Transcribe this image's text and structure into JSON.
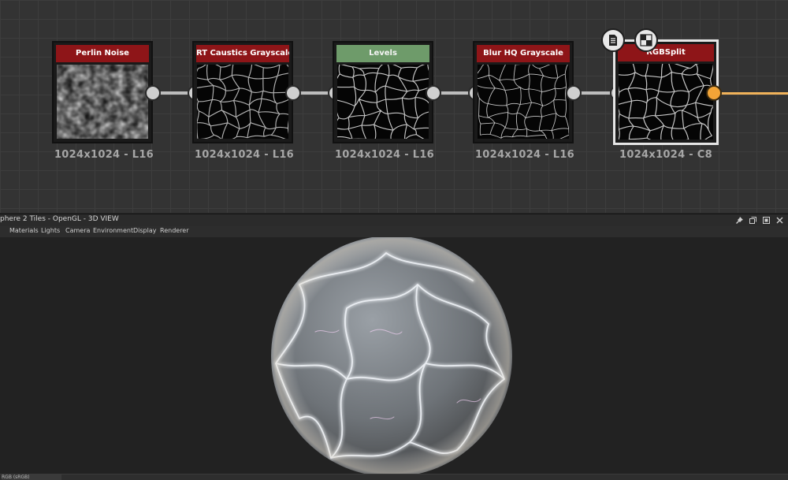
{
  "graph": {
    "nodes": [
      {
        "title": "Perlin Noise",
        "label": "1024x1024 - L16"
      },
      {
        "title": "RT Caustics Grayscale",
        "label": "1024x1024 - L16"
      },
      {
        "title": "Levels",
        "label": "1024x1024 - L16"
      },
      {
        "title": "Blur HQ Grayscale",
        "label": "1024x1024 - L16"
      },
      {
        "title": "RGBSplit",
        "label": "1024x1024 - C8"
      }
    ],
    "badges": [
      "document-icon",
      "checker-icon"
    ],
    "colors": {
      "title_red": "#8e1518",
      "title_green": "#6e9b6a",
      "output_socket": "#f2a437"
    }
  },
  "view": {
    "title": "phere 2 Tiles - OpenGL - 3D VIEW",
    "menu": [
      "Materials",
      "Lights",
      "Camera",
      "Environment",
      "Display",
      "Renderer"
    ],
    "window_icons": [
      "pin-icon",
      "restore-icon",
      "maximize-icon",
      "close-icon"
    ],
    "bottom_tab": "RGB (sRGB)"
  }
}
